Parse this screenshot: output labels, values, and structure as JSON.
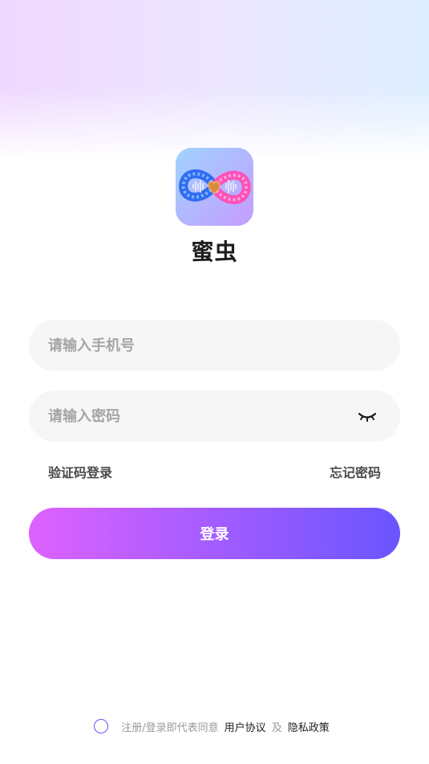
{
  "app": {
    "name": "蜜虫"
  },
  "form": {
    "phone_placeholder": "请输入手机号",
    "password_placeholder": "请输入密码",
    "sms_login_label": "验证码登录",
    "forgot_password_label": "忘记密码",
    "login_label": "登录"
  },
  "agreement": {
    "prefix": "注册/登录即代表同意",
    "user_agreement": "用户协议",
    "and": "及",
    "privacy_policy": "隐私政策"
  },
  "icons": {
    "password_toggle": "eye-closed-icon",
    "logo": "infinity-heart-logo"
  },
  "colors": {
    "accent_start": "#de62ff",
    "accent_end": "#6a55ff"
  }
}
